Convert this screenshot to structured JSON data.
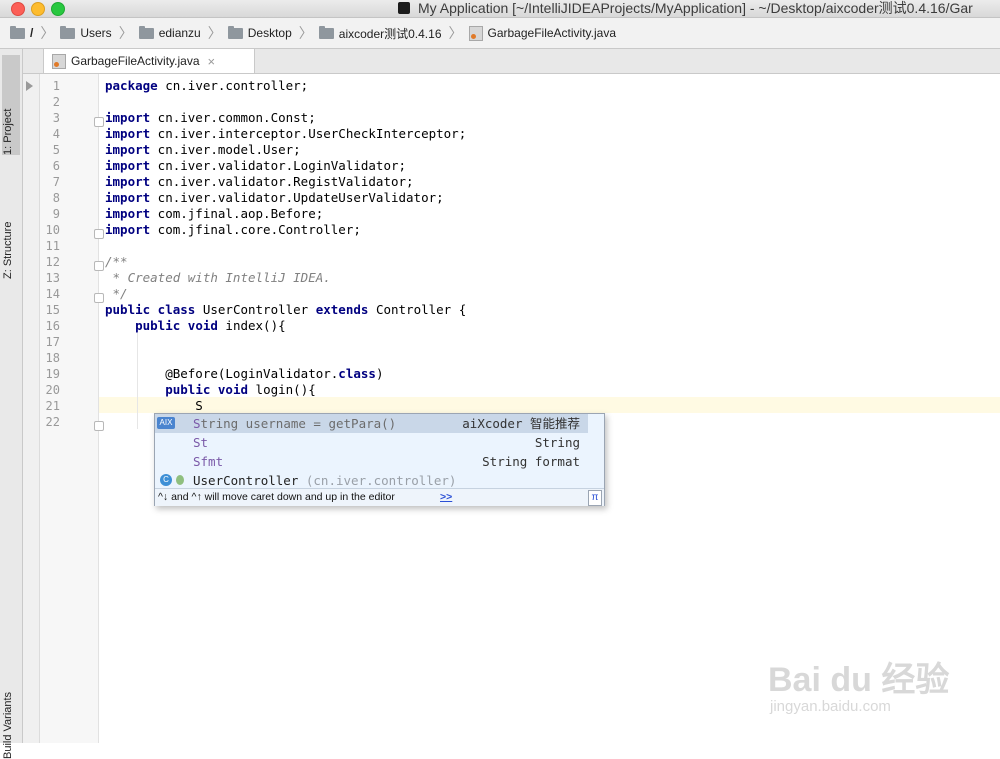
{
  "window": {
    "title": "My Application [~/IntelliJIDEAProjects/MyApplication] - ~/Desktop/aixcoder测试0.4.16/Gar"
  },
  "breadcrumb": {
    "items": [
      "/",
      "Users",
      "edianzu",
      "Desktop",
      "aixcoder测试0.4.16",
      "GarbageFileActivity.java"
    ]
  },
  "left_panel": {
    "tabs": [
      "1: Project",
      "Z: Structure",
      "Build Variants"
    ]
  },
  "editor_tabs": {
    "active": "GarbageFileActivity.java",
    "close": "×"
  },
  "editor": {
    "line_numbers": [
      "1",
      "2",
      "3",
      "4",
      "5",
      "6",
      "7",
      "8",
      "9",
      "10",
      "11",
      "12",
      "13",
      "14",
      "15",
      "16",
      "17",
      "18",
      "19",
      "20",
      "21",
      "22"
    ],
    "current_line": "21",
    "code_lines": [
      [
        {
          "t": "package",
          "c": "kw"
        },
        {
          "t": " cn.iver.controller;",
          "c": ""
        }
      ],
      [],
      [
        {
          "t": "import",
          "c": "kw"
        },
        {
          "t": " cn.iver.common.Const;",
          "c": ""
        }
      ],
      [
        {
          "t": "import",
          "c": "kw"
        },
        {
          "t": " cn.iver.interceptor.UserCheckInterceptor;",
          "c": ""
        }
      ],
      [
        {
          "t": "import",
          "c": "kw"
        },
        {
          "t": " cn.iver.model.User;",
          "c": ""
        }
      ],
      [
        {
          "t": "import",
          "c": "kw"
        },
        {
          "t": " cn.iver.validator.LoginValidator;",
          "c": ""
        }
      ],
      [
        {
          "t": "import",
          "c": "kw"
        },
        {
          "t": " cn.iver.validator.RegistValidator;",
          "c": ""
        }
      ],
      [
        {
          "t": "import",
          "c": "kw"
        },
        {
          "t": " cn.iver.validator.UpdateUserValidator;",
          "c": ""
        }
      ],
      [
        {
          "t": "import",
          "c": "kw"
        },
        {
          "t": " com.jfinal.aop.Before;",
          "c": ""
        }
      ],
      [
        {
          "t": "import",
          "c": "kw"
        },
        {
          "t": " com.jfinal.core.Controller;",
          "c": ""
        }
      ],
      [],
      [
        {
          "t": "/**",
          "c": "cm"
        }
      ],
      [
        {
          "t": " * Created with IntelliJ IDEA.",
          "c": "cm"
        }
      ],
      [
        {
          "t": " */",
          "c": "cm"
        }
      ],
      [
        {
          "t": "public class",
          "c": "kw"
        },
        {
          "t": " UserController ",
          "c": ""
        },
        {
          "t": "extends",
          "c": "kw"
        },
        {
          "t": " Controller {",
          "c": ""
        }
      ],
      [
        {
          "t": "    ",
          "c": ""
        },
        {
          "t": "public void",
          "c": "kw"
        },
        {
          "t": " index(){",
          "c": ""
        }
      ],
      [],
      [],
      [
        {
          "t": "        @Before(LoginValidator.",
          "c": ""
        },
        {
          "t": "class",
          "c": "kw"
        },
        {
          "t": ")",
          "c": ""
        }
      ],
      [
        {
          "t": "        ",
          "c": ""
        },
        {
          "t": "public void",
          "c": "kw"
        },
        {
          "t": " login(){",
          "c": ""
        }
      ],
      [
        {
          "t": "            S",
          "c": ""
        }
      ],
      []
    ]
  },
  "completion": {
    "items": [
      {
        "icon": "AIX",
        "prefix": "S",
        "rest": "tring username = getPara()",
        "type": "aiXcoder 智能推荐",
        "selected": true
      },
      {
        "icon": "",
        "prefix": "St",
        "rest": "",
        "type": "String",
        "selected": false
      },
      {
        "icon": "",
        "prefix": "Sfmt",
        "rest": "",
        "type": "String format",
        "selected": false
      },
      {
        "icon": "C",
        "prefix": "UserController",
        "rest": "",
        "detail": " (cn.iver.controller)",
        "type": "",
        "selected": false
      }
    ],
    "footer_text": "^↓ and ^↑ will move caret down and up in the editor",
    "footer_link": ">>",
    "pi_button": "π"
  },
  "watermark": {
    "brand": "Bai du 经验",
    "url": "jingyan.baidu.com"
  },
  "colors": {
    "keyword": "#000080",
    "comment": "#808080",
    "annotation": "#808000",
    "completion_match": "#7a59a8",
    "caret_line": "#fffae3"
  }
}
